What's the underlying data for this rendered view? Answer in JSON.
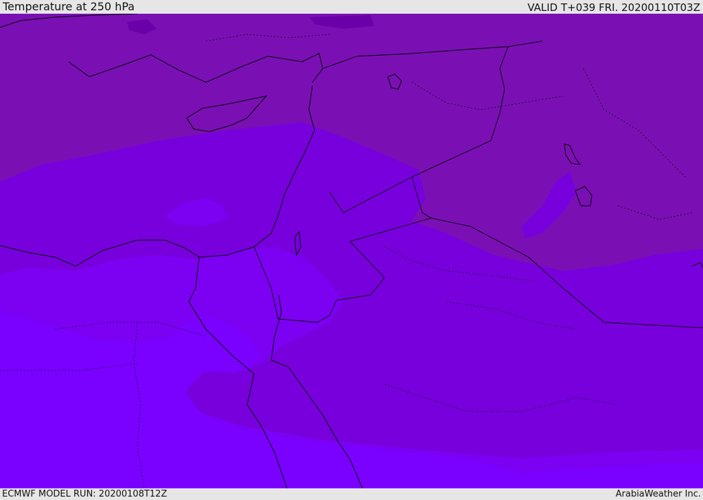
{
  "header": {
    "title": "Temperature at 250 hPa",
    "valid": "VALID T+039 FRI. 20200110T03Z"
  },
  "footer": {
    "model_run": "ECMWF MODEL RUN: 20200108T12Z",
    "brand": "ArabiaWeather Inc."
  },
  "colors": {
    "band_coldest": "#6a00a8",
    "band_cold": "#7a10b4",
    "band_mid": "#7800dc",
    "band_warm": "#7c00f2",
    "band_warmest": "#7a00ff",
    "coastline": "#000000",
    "chrome_background": "#e6e6e6"
  }
}
